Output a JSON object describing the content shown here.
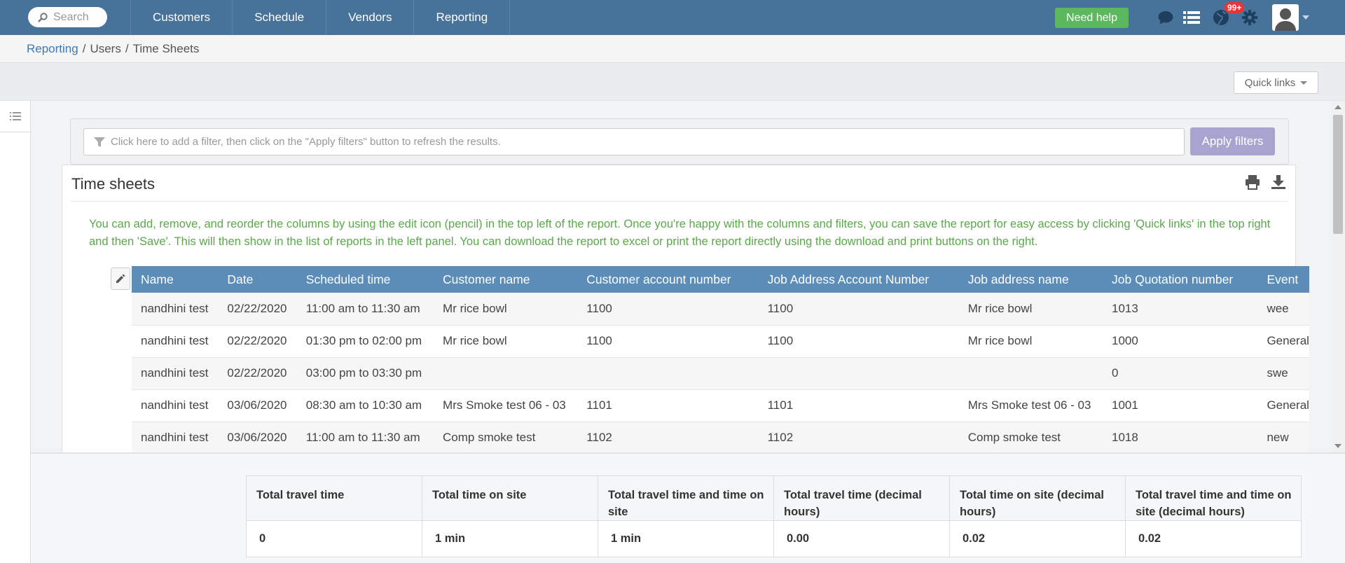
{
  "nav": {
    "search_placeholder": "Search",
    "links": [
      "Customers",
      "Schedule",
      "Vendors",
      "Reporting"
    ],
    "need_help": "Need help",
    "notifications_badge": "99+"
  },
  "breadcrumb": {
    "root": "Reporting",
    "sep1": "/",
    "users": "Users",
    "sep2": "/",
    "current": "Time Sheets"
  },
  "toolbar": {
    "quick_links": "Quick links"
  },
  "filters": {
    "placeholder": "Click here to add a filter, then click on the \"Apply filters\" button to refresh the results.",
    "apply_label": "Apply filters"
  },
  "report": {
    "title": "Time sheets",
    "info": "You can add, remove, and reorder the columns by using the edit icon (pencil) in the top left of the report. Once you're happy with the columns and filters, you can save the report for easy access by clicking 'Quick links' in the top right and then 'Save'. This will then show in the list of reports in the left panel. You can download the report to excel or print the report directly using the download and print buttons on the right.",
    "columns": [
      "Name",
      "Date",
      "Scheduled time",
      "Customer name",
      "Customer account number",
      "Job Address Account Number",
      "Job address name",
      "Job Quotation number",
      "Event"
    ],
    "rows": [
      [
        "nandhini test",
        "02/22/2020",
        "11:00 am to 11:30 am",
        "Mr rice bowl",
        "1100",
        "1100",
        "Mr rice bowl",
        "1013",
        "wee"
      ],
      [
        "nandhini test",
        "02/22/2020",
        "01:30 pm to 02:00 pm",
        "Mr rice bowl",
        "1100",
        "1100",
        "Mr rice bowl",
        "1000",
        "General"
      ],
      [
        "nandhini test",
        "02/22/2020",
        "03:00 pm to 03:30 pm",
        "",
        "",
        "",
        "",
        "0",
        "swe"
      ],
      [
        "nandhini test",
        "03/06/2020",
        "08:30 am to 10:30 am",
        "Mrs Smoke test 06 - 03",
        "1101",
        "1101",
        "Mrs Smoke test 06 - 03",
        "1001",
        "General"
      ],
      [
        "nandhini test",
        "03/06/2020",
        "11:00 am to 11:30 am",
        "Comp smoke test",
        "1102",
        "1102",
        "Comp smoke test",
        "1018",
        "new"
      ]
    ]
  },
  "totals": {
    "headers": [
      "Total travel time",
      "Total time on site",
      "Total travel time and time on site",
      "Total travel time (decimal hours)",
      "Total time on site (decimal hours)",
      "Total travel time and time on site (decimal hours)"
    ],
    "values": [
      "0",
      "1 min",
      "1 min",
      "0.00",
      "0.02",
      "0.02"
    ]
  },
  "colors": {
    "nav_bg": "#47729a",
    "table_header_bg": "#5b8db8",
    "info_text": "#5aa84a",
    "need_help_bg": "#5cb85c",
    "apply_bg": "#a9a4cf",
    "link": "#3f79b4"
  },
  "icons": [
    "search-icon",
    "chat-icon",
    "list-icon",
    "globe-icon",
    "gear-icon",
    "user-avatar-icon",
    "menu-icon",
    "filter-icon",
    "print-icon",
    "download-icon",
    "pencil-icon"
  ]
}
